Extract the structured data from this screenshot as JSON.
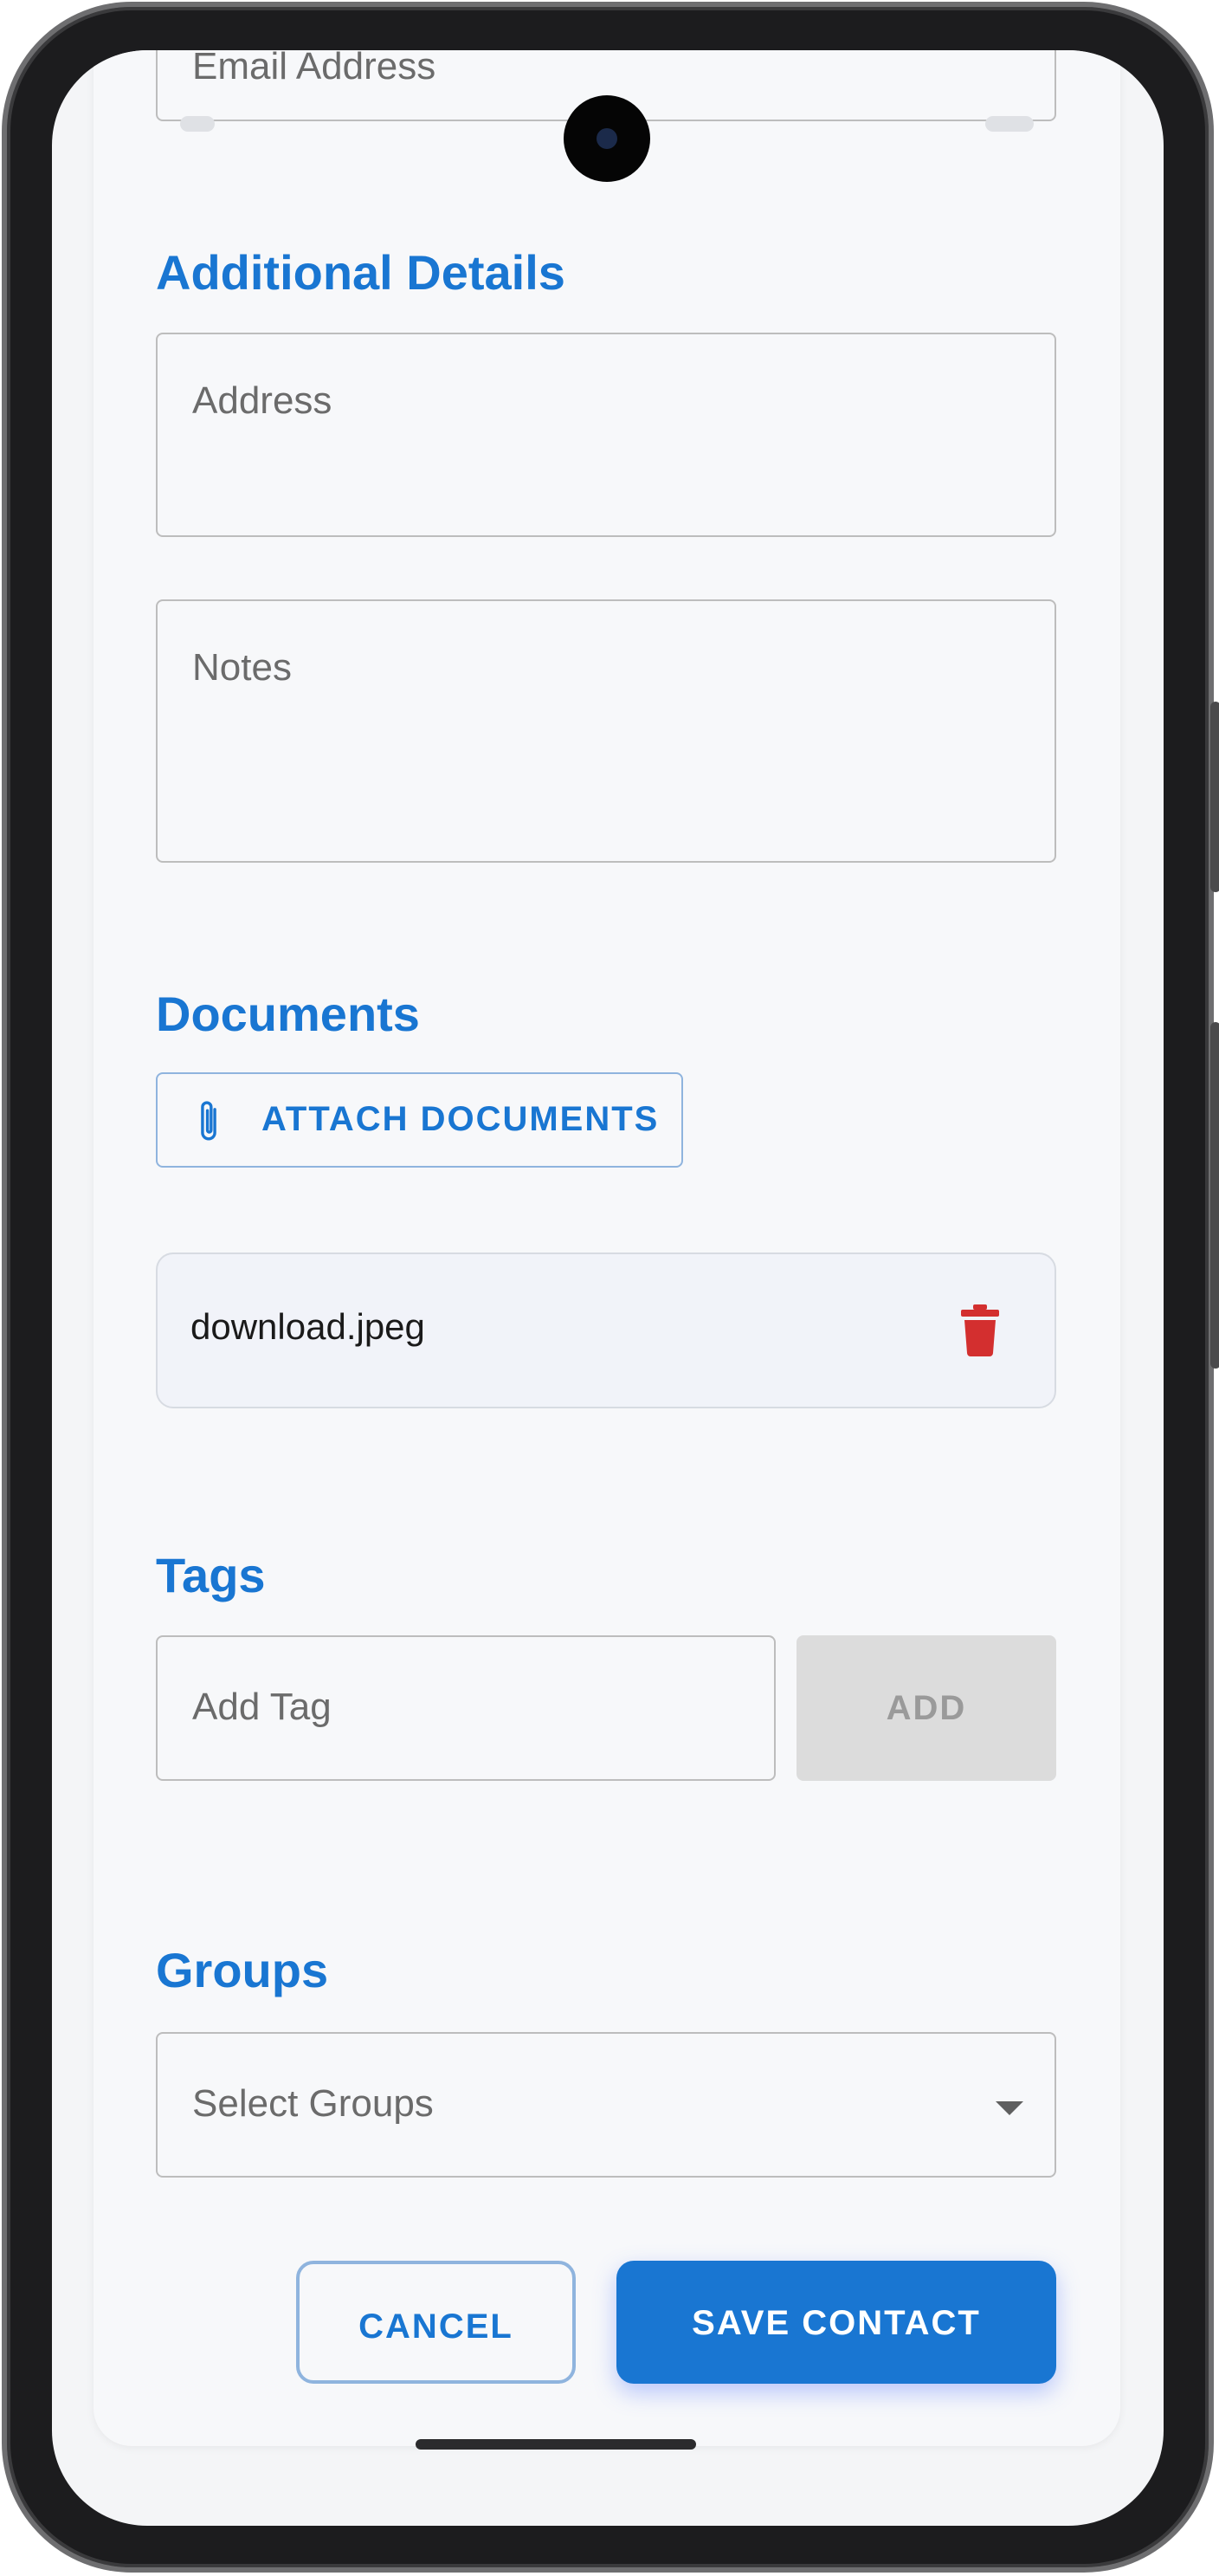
{
  "contact_form": {
    "email_field": {
      "placeholder": "Email Address"
    },
    "additional_details": {
      "title": "Additional Details",
      "address": {
        "placeholder": "Address",
        "value": ""
      },
      "notes": {
        "placeholder": "Notes",
        "value": ""
      }
    },
    "documents": {
      "title": "Documents",
      "attach_button_label": "ATTACH DOCUMENTS",
      "attach_icon": "paperclip-icon",
      "files": [
        {
          "name": "download.jpeg",
          "delete_icon": "trash-icon"
        }
      ]
    },
    "tags": {
      "title": "Tags",
      "input": {
        "placeholder": "Add Tag",
        "value": ""
      },
      "add_button_label": "ADD"
    },
    "groups": {
      "title": "Groups",
      "select": {
        "placeholder": "Select Groups",
        "icon": "chevron-down-icon"
      }
    },
    "actions": {
      "cancel_label": "CANCEL",
      "save_label": "SAVE CONTACT"
    }
  },
  "colors": {
    "accent": "#1976d2",
    "danger": "#d32f2f",
    "disabled_bg": "#dcdcdc",
    "disabled_text": "#9a9a9a"
  }
}
